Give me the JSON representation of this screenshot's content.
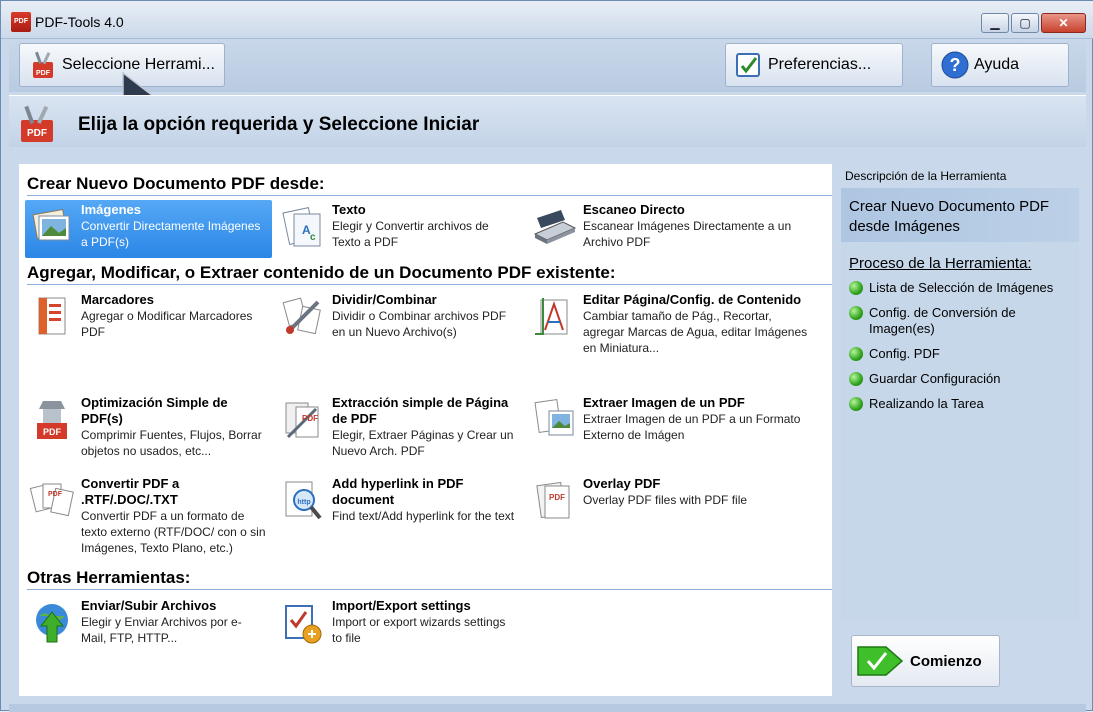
{
  "window": {
    "title": "PDF-Tools 4.0",
    "app_icon_text": "PDF"
  },
  "toolbar": {
    "select_tool": "Seleccione Herrami...",
    "preferences": "Preferencias...",
    "help": "Ayuda"
  },
  "header": {
    "title": "Elija la opción requerida y Seleccione Iniciar"
  },
  "sections": {
    "create": "Crear Nuevo Documento PDF desde:",
    "modify": "Agregar, Modificar, o Extraer contenido de un Documento PDF existente:",
    "other": "Otras Herramientas:"
  },
  "tools": [
    {
      "name": "Imágenes",
      "desc": "Convertir Directamente Imágenes a PDF(s)",
      "icon": "images-icon"
    },
    {
      "name": "Texto",
      "desc": "Elegir y Convertir archivos de Texto a PDF",
      "icon": "text-icon"
    },
    {
      "name": "Escaneo Directo",
      "desc": "Escanear Imágenes Directamente a un Archivo PDF",
      "icon": "scanner-icon"
    },
    {
      "name": "Marcadores",
      "desc": "Agregar o Modificar Marcadores PDF",
      "icon": "bookmarks-icon"
    },
    {
      "name": "Dividir/Combinar",
      "desc": "Dividir o Combinar archivos PDF en un Nuevo Archivo(s)",
      "icon": "split-merge-icon"
    },
    {
      "name": "Editar Página/Config. de Contenido",
      "desc": "Cambiar tamaño de Pág., Recortar, agregar Marcas de Agua, editar Imágenes en Miniatura...",
      "icon": "edit-page-icon"
    },
    {
      "name": "Optimización Simple de PDF(s)",
      "desc": "Comprimir Fuentes, Flujos, Borrar objetos no usados, etc...",
      "icon": "optimize-icon"
    },
    {
      "name": "Extracción simple de Página de PDF",
      "desc": "Elegir, Extraer Páginas y Crear un Nuevo Arch. PDF",
      "icon": "extract-page-icon"
    },
    {
      "name": "Extraer Imagen de un PDF",
      "desc": "Extraer Imagen de un PDF a un Formato Externo de Imágen",
      "icon": "extract-image-icon"
    },
    {
      "name": "Convertir PDF a .RTF/.DOC/.TXT",
      "desc": "Convertir PDF a un formato de texto externo (RTF/DOC/ con o sin Imágenes, Texto Plano, etc.)",
      "icon": "convert-doc-icon"
    },
    {
      "name": "Add hyperlink in PDF document",
      "desc": "Find text/Add hyperlink for the text",
      "icon": "hyperlink-icon"
    },
    {
      "name": "Overlay PDF",
      "desc": "Overlay PDF files with PDF file",
      "icon": "overlay-icon"
    },
    {
      "name": "Enviar/Subir Archivos",
      "desc": "Elegir y Enviar Archivos por e-Mail, FTP, HTTP...",
      "icon": "upload-icon"
    },
    {
      "name": "Import/Export settings",
      "desc": "Import or export wizards settings to file",
      "icon": "import-export-icon"
    }
  ],
  "right": {
    "desc_label": "Descripción de la Herramienta",
    "desc_text": "Crear Nuevo Documento PDF desde Imágenes",
    "process_title": "Proceso de la Herramienta:",
    "steps": [
      "Lista de Selección de Imágenes",
      "Config. de Conversión de Imagen(es)",
      "Config. PDF",
      "Guardar Configuración",
      "Realizando la Tarea"
    ]
  },
  "start_button": "Comienzo"
}
